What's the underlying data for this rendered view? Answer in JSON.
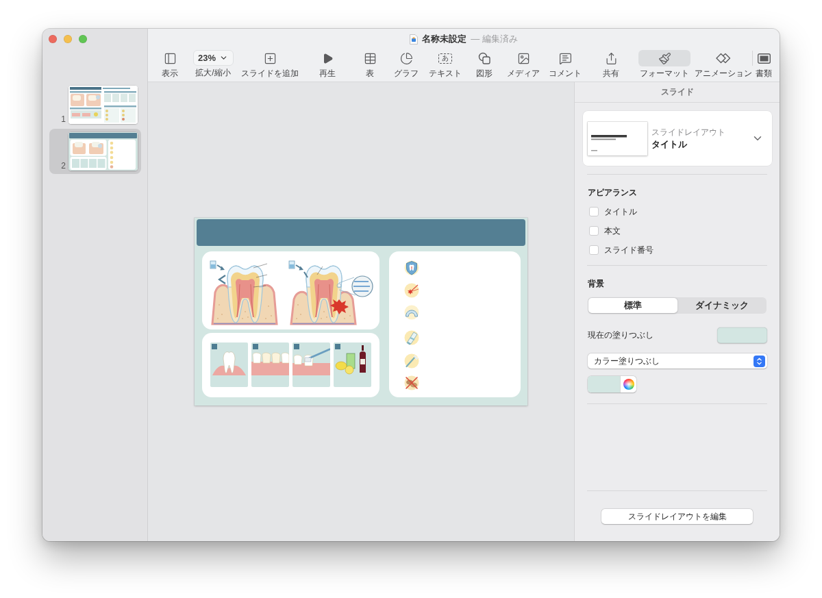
{
  "window": {
    "title": "名称未設定",
    "status": "— 編集済み"
  },
  "toolbar": [
    {
      "kind": "view",
      "label": "表示",
      "selected": false
    },
    {
      "kind": "zoom",
      "value": "23%",
      "label": "拡大/縮小",
      "selected": false
    },
    {
      "kind": "add_slide",
      "label": "スライドを追加",
      "selected": false
    },
    {
      "kind": "play",
      "label": "再生",
      "selected": false
    },
    {
      "kind": "table",
      "label": "表",
      "selected": false
    },
    {
      "kind": "chart",
      "label": "グラフ",
      "selected": false
    },
    {
      "kind": "text",
      "glyph": "あ",
      "label": "テキスト",
      "selected": false
    },
    {
      "kind": "shape",
      "label": "図形",
      "selected": false
    },
    {
      "kind": "media",
      "label": "メディア",
      "selected": false
    },
    {
      "kind": "comment",
      "label": "コメント",
      "selected": false
    },
    {
      "kind": "share",
      "label": "共有",
      "selected": false
    },
    {
      "kind": "format",
      "label": "フォーマット",
      "selected": true
    },
    {
      "kind": "animate",
      "label": "アニメーション",
      "selected": false
    },
    {
      "kind": "document",
      "label": "書類",
      "selected": false
    }
  ],
  "slides": [
    {
      "number": "1",
      "selected": false
    },
    {
      "number": "2",
      "selected": true
    }
  ],
  "inspector": {
    "title": "スライド",
    "layout": {
      "caption": "スライドレイアウト",
      "name": "タイトル"
    },
    "appearance": {
      "heading": "アピアランス",
      "options": [
        {
          "label": "タイトル",
          "checked": false
        },
        {
          "label": "本文",
          "checked": false
        },
        {
          "label": "スライド番号",
          "checked": false
        }
      ]
    },
    "background": {
      "heading": "背景",
      "modes": [
        {
          "label": "標準",
          "selected": true
        },
        {
          "label": "ダイナミック",
          "selected": false
        }
      ],
      "current_fill": "現在の塗りつぶし",
      "fill_type": "カラー塗りつぶし"
    },
    "edit_layout_button": "スライドレイアウトを編集"
  }
}
